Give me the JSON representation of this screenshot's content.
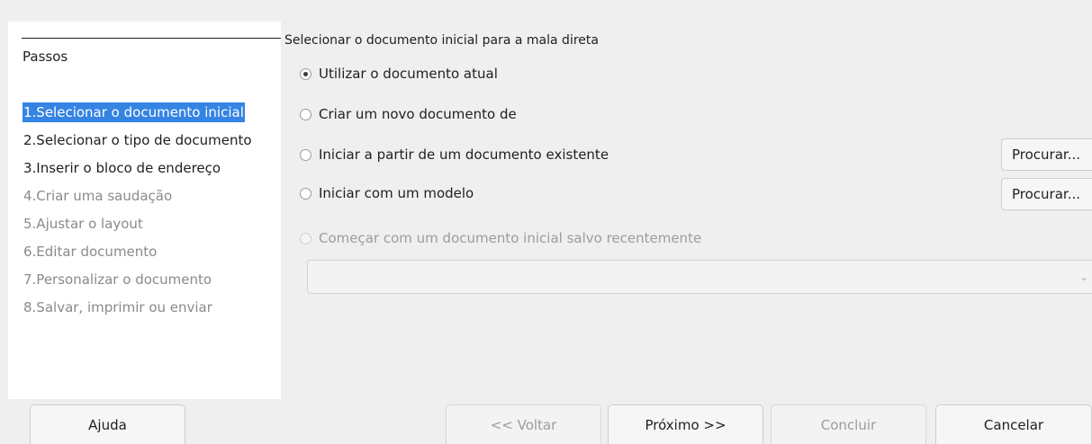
{
  "sidebar": {
    "title": "Passos",
    "steps": [
      {
        "label": "1.Selecionar o documento inicial",
        "state": "active"
      },
      {
        "label": "2.Selecionar o tipo de documento",
        "state": "enabled"
      },
      {
        "label": "3.Inserir o bloco de endereço",
        "state": "enabled"
      },
      {
        "label": "4.Criar uma saudação",
        "state": "disabled"
      },
      {
        "label": "5.Ajustar o layout",
        "state": "disabled"
      },
      {
        "label": "6.Editar documento",
        "state": "disabled"
      },
      {
        "label": "7.Personalizar o documento",
        "state": "disabled"
      },
      {
        "label": "8.Salvar, imprimir ou enviar",
        "state": "disabled"
      }
    ]
  },
  "main": {
    "title": "Selecionar o documento inicial para a mala direta",
    "options": {
      "use_current": "Utilizar o documento atual",
      "create_new": "Criar um novo documento de",
      "start_existing": "Iniciar a partir de um documento existente",
      "start_template": "Iniciar com um modelo",
      "start_recent": "Começar com um documento inicial salvo recentemente"
    },
    "selected_option": "use_current",
    "browse_label": "Procurar...",
    "recent_combo_value": ""
  },
  "footer": {
    "help": "Ajuda",
    "back": "<< Voltar",
    "next": "Próximo >>",
    "finish": "Concluir",
    "cancel": "Cancelar"
  }
}
